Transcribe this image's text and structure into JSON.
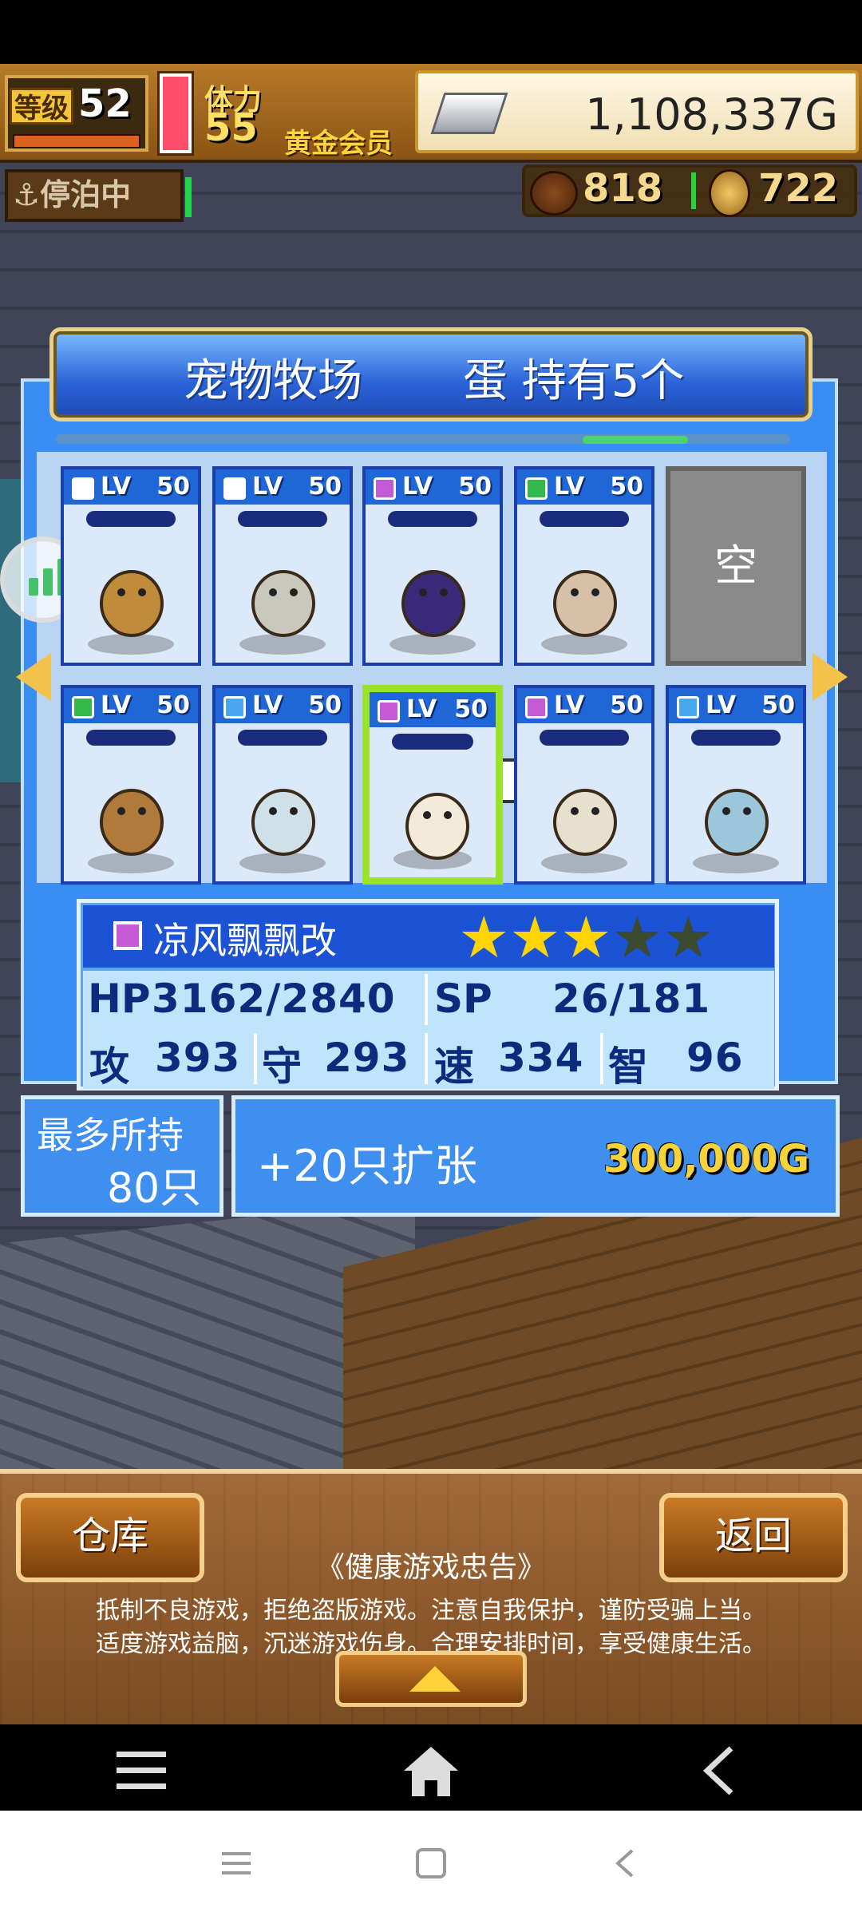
{
  "hud": {
    "level_label": "等级",
    "level": "52",
    "stamina_label": "体力",
    "stamina": "55",
    "vip_label": "黄金会员",
    "gold": "1,108,337G",
    "anchor_label": "停泊中",
    "resource1": "818",
    "resource2": "722"
  },
  "panel": {
    "title": "宠物牧场",
    "eggs": "蛋 持有5个"
  },
  "cards": [
    {
      "lv_label": "LV",
      "lv": "50",
      "elem_color": "#ffffff",
      "sprite": "dinosaur-sprite",
      "body": "#c08c3c"
    },
    {
      "lv_label": "LV",
      "lv": "50",
      "elem_color": "#ffffff",
      "sprite": "rock-sprite",
      "body": "#c8c8bc"
    },
    {
      "lv_label": "LV",
      "lv": "50",
      "elem_color": "#c55ad6",
      "sprite": "dark-beast-sprite",
      "body": "#3a2a7a"
    },
    {
      "lv_label": "LV",
      "lv": "50",
      "elem_color": "#35b94b",
      "sprite": "mushroom-sprite",
      "body": "#d8bfa8"
    },
    {
      "lv_label": "LV",
      "lv": "50",
      "elem_color": "#35b94b",
      "sprite": "tree-stump-sprite",
      "body": "#b07a3a"
    },
    {
      "lv_label": "LV",
      "lv": "50",
      "elem_color": "#49a8f0",
      "sprite": "ice-crystal-sprite",
      "body": "#cfe0e8"
    },
    {
      "lv_label": "LV",
      "lv": "50",
      "elem_color": "#c55ad6",
      "sprite": "ghost-sprite",
      "body": "#f3ead8"
    },
    {
      "lv_label": "LV",
      "lv": "50",
      "elem_color": "#c55ad6",
      "sprite": "bone-dragon-sprite",
      "body": "#e7e0cc"
    },
    {
      "lv_label": "LV",
      "lv": "50",
      "elem_color": "#49a8f0",
      "sprite": "ice-fish-sprite",
      "body": "#9cc7da"
    }
  ],
  "empty_slot": "空",
  "selected": {
    "name": "凉风飘飘改",
    "stars_filled": 3,
    "stars_total": 5,
    "hp_label": "HP",
    "hp": "3162/2840",
    "sp_label": "SP",
    "sp": "26/181",
    "atk_label": "攻",
    "atk": "393",
    "def_label": "守",
    "def": "293",
    "spd_label": "速",
    "spd": "334",
    "int_label": "智",
    "int": "96"
  },
  "capacity": {
    "max_label": "最多所持",
    "max_value": "80只",
    "expand_label": "+20只扩张",
    "expand_cost": "300,000G"
  },
  "bottom": {
    "warehouse": "仓库",
    "back": "返回",
    "notice_title": "《健康游戏忠告》",
    "notice_line1": "抵制不良游戏，拒绝盗版游戏。注意自我保护，谨防受骗上当。",
    "notice_line2": "适度游戏益脑，沉迷游戏伤身。合理安排时间，享受健康生活。"
  },
  "icons": {
    "menu": "menu-icon",
    "home": "home-icon",
    "back": "back-arrow-icon"
  }
}
